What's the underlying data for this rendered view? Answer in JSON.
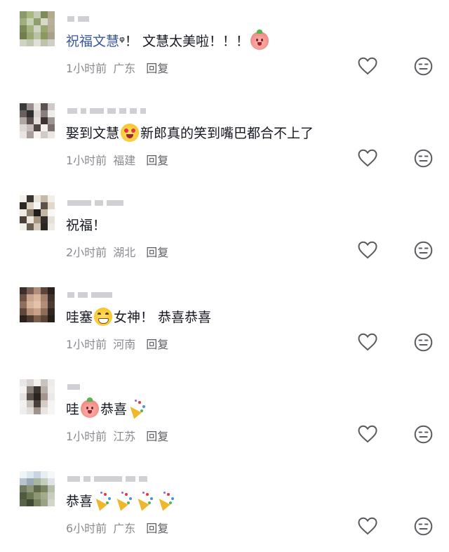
{
  "comments": [
    {
      "avatar_colors": [
        "#8a9a6a",
        "#a9b87d",
        "#c5c9b8",
        "#7d8a5a",
        "#b2a98e",
        "#9fae7c",
        "#c7cfb4",
        "#8e9f6e",
        "#d8d8c8",
        "#b8b09a",
        "#7b8858",
        "#a5b381",
        "#cfd4c1",
        "#98a672",
        "#b5ad93",
        "#6f7d4f",
        "#9aa774",
        "#b9c2a6",
        "#8b985f",
        "#a8a08a",
        "#d0d3c4",
        "#c1c8b0",
        "#e0e0d6",
        "#bdc4ab",
        "#cfd1c6"
      ],
      "text_parts": [
        {
          "type": "mention",
          "text": "祝福文慧"
        },
        {
          "type": "text",
          "text": "ᵠ！ 文慧太美啦！！！"
        },
        {
          "type": "emoji",
          "icon": "peach-emoji-icon"
        }
      ],
      "time": "1小时前",
      "location": "广东",
      "reply_label": "回复"
    },
    {
      "avatar_colors": [
        "#3a3a3a",
        "#9a8f8f",
        "#e8e4e2",
        "#5b5151",
        "#cfcac8",
        "#6a5f5f",
        "#2e2e2e",
        "#d8d2d0",
        "#8a7f7f",
        "#f0ecea",
        "#b0a6a4",
        "#5a4f4f",
        "#e3dedc",
        "#3c3434",
        "#9e9492",
        "#ddd8d6",
        "#c6bebc",
        "#4f4646",
        "#f2efed",
        "#7a7070",
        "#e9e5e3",
        "#a89e9c",
        "#f5f2f0",
        "#d1cac8",
        "#eae6e4"
      ],
      "text_parts": [
        {
          "type": "text",
          "text": "娶到文慧"
        },
        {
          "type": "emoji",
          "icon": "heart-eyes-emoji-icon"
        },
        {
          "type": "text",
          "text": "新郎真的笑到嘴巴都合不上了"
        }
      ],
      "time": "1小时前",
      "location": "福建",
      "reply_label": "回复"
    },
    {
      "avatar_colors": [
        "#f4f1ec",
        "#3b352f",
        "#e8e2da",
        "#c7b9a7",
        "#f2efe9",
        "#2c2824",
        "#d9cfc2",
        "#f6f4f0",
        "#5c5248",
        "#e1d8cc",
        "#efeae3",
        "#8d7f70",
        "#1f1c19",
        "#c4b6a4",
        "#faf8f5",
        "#4a4239",
        "#ede7df",
        "#a69684",
        "#332e29",
        "#e7e0d6",
        "#f3f0ea",
        "#6a5f53",
        "#d4c8b8",
        "#2b2621",
        "#eee9e2"
      ],
      "text_parts": [
        {
          "type": "text",
          "text": "祝福！"
        }
      ],
      "time": "2小时前",
      "location": "湖北",
      "reply_label": "回复"
    },
    {
      "avatar_colors": [
        "#3a2f2a",
        "#7a5e50",
        "#b28d78",
        "#5a463c",
        "#2a211c",
        "#6b5244",
        "#c9a48c",
        "#d9b59c",
        "#a3816c",
        "#3f322b",
        "#8e6f5e",
        "#d6b29a",
        "#e3c2a9",
        "#b18e78",
        "#4a3a31",
        "#5e483c",
        "#b68f78",
        "#c8a188",
        "#8d6d5a",
        "#30261f",
        "#2b221d",
        "#4d3b31",
        "#7b5e4d",
        "#5a4538",
        "#261e19"
      ],
      "text_parts": [
        {
          "type": "text",
          "text": "哇塞"
        },
        {
          "type": "emoji",
          "icon": "grinning-emoji-icon"
        },
        {
          "type": "text",
          "text": "女神！ 恭喜恭喜"
        }
      ],
      "time": "1小时前",
      "location": "河南",
      "reply_label": "回复"
    },
    {
      "avatar_colors": [
        "#e9e7e6",
        "#d6d1cf",
        "#f2f0ef",
        "#c9c3c0",
        "#ecebea",
        "#f4f3f2",
        "#8a7e78",
        "#3d3531",
        "#b9afaa",
        "#f0efee",
        "#e6e3e1",
        "#5c514b",
        "#2a2421",
        "#a2968f",
        "#ebe9e8",
        "#f3f2f1",
        "#c7bfba",
        "#4a403b",
        "#d4ccc7",
        "#f5f4f3",
        "#efeeed",
        "#e2dedb",
        "#9e928b",
        "#e8e5e3",
        "#f6f5f4"
      ],
      "text_parts": [
        {
          "type": "text",
          "text": "哇"
        },
        {
          "type": "emoji",
          "icon": "peach-emoji-icon"
        },
        {
          "type": "text",
          "text": "恭喜"
        },
        {
          "type": "emoji",
          "icon": "party-popper-icon"
        }
      ],
      "time": "1小时前",
      "location": "江苏",
      "reply_label": "回复"
    },
    {
      "avatar_colors": [
        "#f1f4f7",
        "#dfe7ee",
        "#c9d6e2",
        "#e7edf3",
        "#f5f7f9",
        "#b7c4cf",
        "#9aa9b5",
        "#a8b5a0",
        "#c3cdb9",
        "#dde3e8",
        "#6f7a5e",
        "#8c9778",
        "#5e6a4d",
        "#7a8663",
        "#b6bea9",
        "#4f5a40",
        "#6c7752",
        "#8d9773",
        "#a3ab8c",
        "#c8cdbd",
        "#5a6348",
        "#3f4833",
        "#76805f",
        "#9ba283",
        "#d2d6ca"
      ],
      "text_parts": [
        {
          "type": "text",
          "text": "恭喜"
        },
        {
          "type": "emoji",
          "icon": "party-popper-icon"
        },
        {
          "type": "emoji",
          "icon": "party-popper-icon"
        },
        {
          "type": "emoji",
          "icon": "party-popper-icon"
        },
        {
          "type": "emoji",
          "icon": "party-popper-icon"
        }
      ],
      "time": "6小时前",
      "location": "广东",
      "reply_label": "回复"
    }
  ],
  "icons": {
    "like": "heart-outline-icon",
    "dislike": "neutral-face-icon"
  },
  "colors": {
    "text": "#161823",
    "meta": "#8a8b91",
    "mention": "#3b5998",
    "icon_stroke": "#5a5b60"
  }
}
